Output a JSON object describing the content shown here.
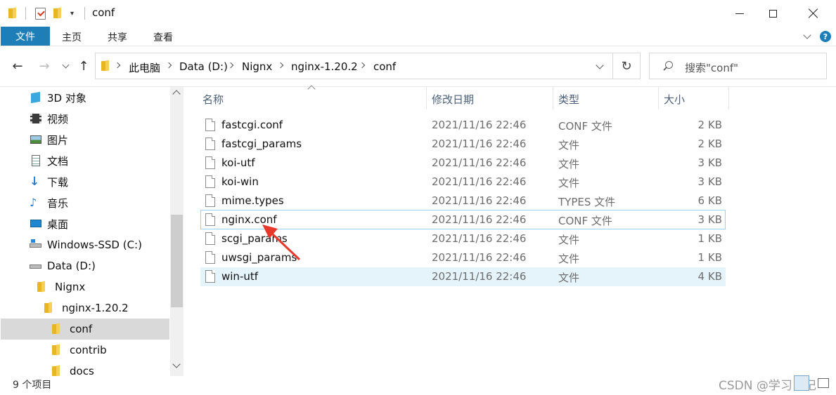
{
  "window": {
    "title": "conf"
  },
  "ribbon": {
    "tabs": [
      "文件",
      "主页",
      "共享",
      "查看"
    ]
  },
  "address": {
    "crumbs": [
      "此电脑",
      "Data (D:)",
      "Nignx",
      "nginx-1.20.2",
      "conf"
    ]
  },
  "search": {
    "placeholder": "搜索\"conf\""
  },
  "sidebar": {
    "items": [
      {
        "label": "3D 对象",
        "icon": "3d-objects-icon"
      },
      {
        "label": "视频",
        "icon": "video-icon"
      },
      {
        "label": "图片",
        "icon": "pictures-icon"
      },
      {
        "label": "文档",
        "icon": "documents-icon"
      },
      {
        "label": "下载",
        "icon": "download-icon"
      },
      {
        "label": "音乐",
        "icon": "music-icon"
      },
      {
        "label": "桌面",
        "icon": "desktop-icon"
      },
      {
        "label": "Windows-SSD (C:)",
        "icon": "drive-c-icon"
      },
      {
        "label": "Data (D:)",
        "icon": "drive-d-icon"
      },
      {
        "label": "Nignx",
        "icon": "folder-icon"
      },
      {
        "label": "nginx-1.20.2",
        "icon": "folder-icon"
      },
      {
        "label": "conf",
        "icon": "folder-icon",
        "selected": true
      },
      {
        "label": "contrib",
        "icon": "folder-icon"
      },
      {
        "label": "docs",
        "icon": "folder-icon"
      }
    ]
  },
  "columns": {
    "name": "名称",
    "date": "修改日期",
    "type": "类型",
    "size": "大小"
  },
  "files": [
    {
      "name": "fastcgi.conf",
      "date": "2021/11/16 22:46",
      "type": "CONF 文件",
      "size": "2 KB"
    },
    {
      "name": "fastcgi_params",
      "date": "2021/11/16 22:46",
      "type": "文件",
      "size": "2 KB"
    },
    {
      "name": "koi-utf",
      "date": "2021/11/16 22:46",
      "type": "文件",
      "size": "3 KB"
    },
    {
      "name": "koi-win",
      "date": "2021/11/16 22:46",
      "type": "文件",
      "size": "3 KB"
    },
    {
      "name": "mime.types",
      "date": "2021/11/16 22:46",
      "type": "TYPES 文件",
      "size": "6 KB"
    },
    {
      "name": "nginx.conf",
      "date": "2021/11/16 22:46",
      "type": "CONF 文件",
      "size": "3 KB"
    },
    {
      "name": "scgi_params",
      "date": "2021/11/16 22:46",
      "type": "文件",
      "size": "1 KB"
    },
    {
      "name": "uwsgi_params",
      "date": "2021/11/16 22:46",
      "type": "文件",
      "size": "1 KB"
    },
    {
      "name": "win-utf",
      "date": "2021/11/16 22:46",
      "type": "文件",
      "size": "4 KB"
    }
  ],
  "status": {
    "count": "9 个项目"
  },
  "watermark": "CSDN @学习日记",
  "colors": {
    "accent": "#1e7fb8",
    "selection": "#d9d9d9",
    "hover": "#e5f3fb",
    "annotation_arrow": "#e8382b"
  }
}
